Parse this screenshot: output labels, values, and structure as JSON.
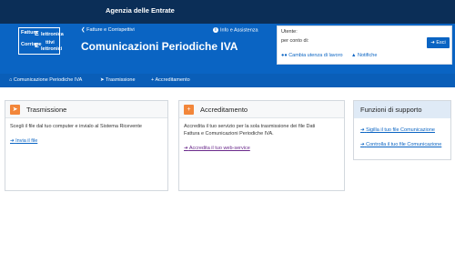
{
  "topbar": {
    "brand": "Agenzia delle Entrate"
  },
  "header": {
    "logo_line1": "Fattura",
    "logo_line1_rest": "lettronica",
    "logo_line2": "Corrispe",
    "logo_line2_rest": "ttivi",
    "logo_line3": "lettronici",
    "link_fatture": "Fatture e Corrispettivi",
    "link_info": "Info e Assistenza",
    "title": "Comunicazioni Periodiche IVA"
  },
  "user": {
    "label": "Utente:",
    "for_label": "per conto di:",
    "change_user": "Cambia utenza di lavoro",
    "notifications": "Notifiche",
    "logout": "Esci"
  },
  "nav": [
    {
      "label": "Comunicazione Periodiche IVA",
      "icon": "home-icon"
    },
    {
      "label": "Trasmissione",
      "icon": "send-icon"
    },
    {
      "label": "Accreditamento",
      "icon": "plus-icon"
    }
  ],
  "cards": {
    "trasmissione": {
      "title": "Trasmissione",
      "text": "Scegli il file dal tuo computer e invialo al Sistema Ricevente",
      "link": "Invia il file"
    },
    "accreditamento": {
      "title": "Accreditamento",
      "text_line1": "Accredita il tuo servizio per la sola trasmissione dei file Dati",
      "text_line2": "Fattura e Comunicazioni Periodiche IVA.",
      "link": "Accredita il tuo web-service"
    }
  },
  "support": {
    "title": "Funzioni di supporto",
    "links": [
      "Sigilla il tuo file Comunicazione",
      "Controlla il tuo file Comunicazione"
    ]
  },
  "colors": {
    "topbar": "#0b2e57",
    "header": "#0a64c3",
    "accent": "#f2863a",
    "link": "#0a64c3"
  }
}
